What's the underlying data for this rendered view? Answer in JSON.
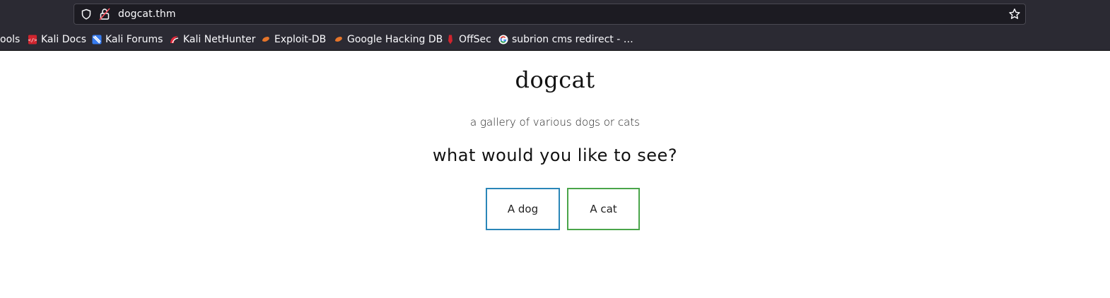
{
  "browser": {
    "url": "dogcat.thm",
    "bookmarks": [
      {
        "label": "ools",
        "icon": "none"
      },
      {
        "label": "Kali Docs",
        "icon": "kali-docs-icon"
      },
      {
        "label": "Kali Forums",
        "icon": "kali-forums-icon"
      },
      {
        "label": "Kali NetHunter",
        "icon": "kali-nethunter-icon"
      },
      {
        "label": "Exploit-DB",
        "icon": "exploit-db-icon"
      },
      {
        "label": "Google Hacking DB",
        "icon": "google-hacking-db-icon"
      },
      {
        "label": "OffSec",
        "icon": "offsec-icon"
      },
      {
        "label": "subrion cms redirect - …",
        "icon": "google-icon"
      }
    ],
    "colors": {
      "toolbar": "#2b2a33",
      "urlbar": "#1c1b22",
      "text": "#fbfbfe"
    }
  },
  "page": {
    "title": "dogcat",
    "subtitle": "a gallery of various dogs or cats",
    "question": "what would you like to see?",
    "buttons": {
      "dog": "A dog",
      "cat": "A cat"
    },
    "colors": {
      "dog_border": "#2a86b8",
      "cat_border": "#4aa54a"
    }
  }
}
